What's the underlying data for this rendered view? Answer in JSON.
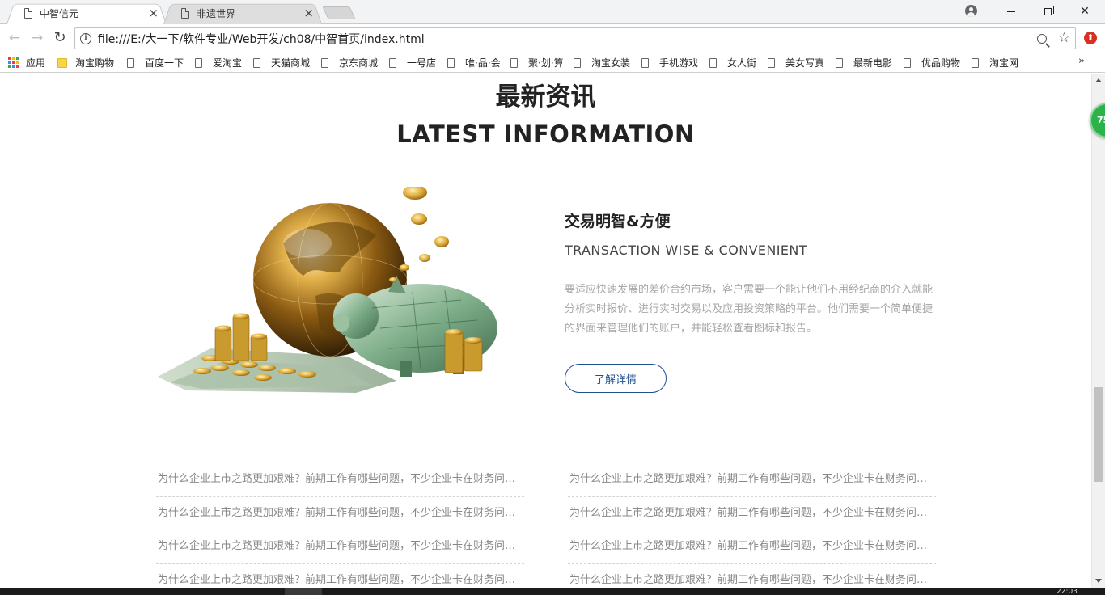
{
  "browser": {
    "tabs": [
      {
        "title": "中智信元",
        "active": true
      },
      {
        "title": "非遗世界",
        "active": false
      }
    ],
    "url": "file:///E:/大一下/软件专业/Web开发/ch08/中智首页/index.html",
    "bookmarks": [
      "应用",
      "淘宝购物",
      "百度一下",
      "爱淘宝",
      "天猫商城",
      "京东商城",
      "一号店",
      "唯·品·会",
      "聚·划·算",
      "淘宝女装",
      "手机游戏",
      "女人街",
      "美女写真",
      "最新电影",
      "优品购物",
      "淘宝网"
    ],
    "extension_badge": "75",
    "icons": {
      "back": "arrow-left-icon",
      "forward": "arrow-right-icon",
      "reload": "reload-icon",
      "info": "info-icon",
      "zoom": "zoom-icon",
      "star": "star-icon",
      "profile": "profile-icon"
    },
    "glyphs": {
      "back": "←",
      "forward": "→",
      "reload": "↻",
      "tab_close": "×",
      "win_close": "✕",
      "star": "☆",
      "more": "»",
      "info": "i"
    }
  },
  "section": {
    "title_cn": "最新资讯",
    "title_en": "LATEST INFORMATION"
  },
  "feature": {
    "title": "交易明智&方便",
    "subtitle": "TRANSACTION WISE & CONVENIENT",
    "description": "要适应快速发展的差价合约市场，客户需要一个能让他们不用经纪商的介入就能分析实时报价、进行实时交易以及应用投资策略的平台。他们需要一个简单便捷的界面来管理他们的账户，并能轻松查看图标和报告。",
    "button_label": "了解详情"
  },
  "news": {
    "left": [
      "为什么企业上市之路更加艰难？前期工作有哪些问题，不少企业卡在财务问题上...",
      "为什么企业上市之路更加艰难？前期工作有哪些问题，不少企业卡在财务问题上...",
      "为什么企业上市之路更加艰难？前期工作有哪些问题，不少企业卡在财务问题上...",
      "为什么企业上市之路更加艰难？前期工作有哪些问题，不少企业卡在财务问题上..."
    ],
    "right": [
      "为什么企业上市之路更加艰难？前期工作有哪些问题，不少企业卡在财务问题上...",
      "为什么企业上市之路更加艰难？前期工作有哪些问题，不少企业卡在财务问题上...",
      "为什么企业上市之路更加艰难？前期工作有哪些问题，不少企业卡在财务问题上...",
      "为什么企业上市之路更加艰难？前期工作有哪些问题，不少企业卡在财务问题上..."
    ]
  },
  "colors": {
    "accent": "#1f4f8f",
    "muted_text": "#a6a6a6",
    "badge_green": "#2bb34a",
    "extension_red": "#d93025"
  },
  "taskbar": {
    "time": "22:03"
  }
}
